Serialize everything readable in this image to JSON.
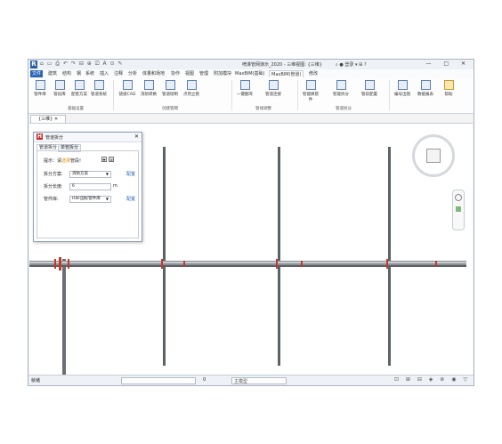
{
  "titlebar": {
    "logo": "R",
    "quick_access": "⌂ ▭ ⎙ ↶ ↷ ⊟ ⊕ ⎚ A ⊙ ✎",
    "title": "喷淋管网演示_2020 - 三维视图: {三维}",
    "user": "登录",
    "window_controls": "— □ ✕"
  },
  "menu": {
    "file": "文件",
    "tabs": [
      "建筑",
      "结构",
      "钢",
      "系统",
      "插入",
      "注释",
      "分析",
      "体量和场地",
      "协作",
      "视图",
      "管理",
      "附加模块",
      "MaxBIM(基础)",
      "MaxBIM(管道)",
      "修改"
    ],
    "active": "MaxBIM(管道)"
  },
  "ribbon": {
    "buttons": [
      "管件库",
      "管段库",
      "配管方案",
      "管道系统",
      "链接CAD",
      "消防转换",
      "管道绘制",
      "点到立管",
      "一键翻弯",
      "管道连接",
      "智能换管件",
      "智能拆分",
      "管段配置",
      "编号出图",
      "数据报表",
      "帮助"
    ],
    "groups": [
      "基础设置",
      "创建管网",
      "管线调整",
      "管道拆分"
    ]
  },
  "document_tab": "{三维}",
  "palette": {
    "title": "管道拆分",
    "tabs": [
      "管道拆分",
      "单管拆分"
    ],
    "hint_prefix": "提示：请",
    "hint_highlight": "选择",
    "hint_suffix": "管段!",
    "rows": [
      {
        "label": "拆分方案:",
        "value": "消防方案",
        "action": "配置"
      },
      {
        "label": "拆分长度:",
        "value": "6",
        "unit": "m"
      },
      {
        "label": "管件库:",
        "value": "HW-国标管件库",
        "action": "配置"
      }
    ]
  },
  "statusbar": {
    "ready": "就绪",
    "count": "0",
    "model": "主模型"
  },
  "colors": {
    "accent": "#2a64b5",
    "pipe_joint": "#c0392b",
    "link": "#1a5fb4"
  }
}
